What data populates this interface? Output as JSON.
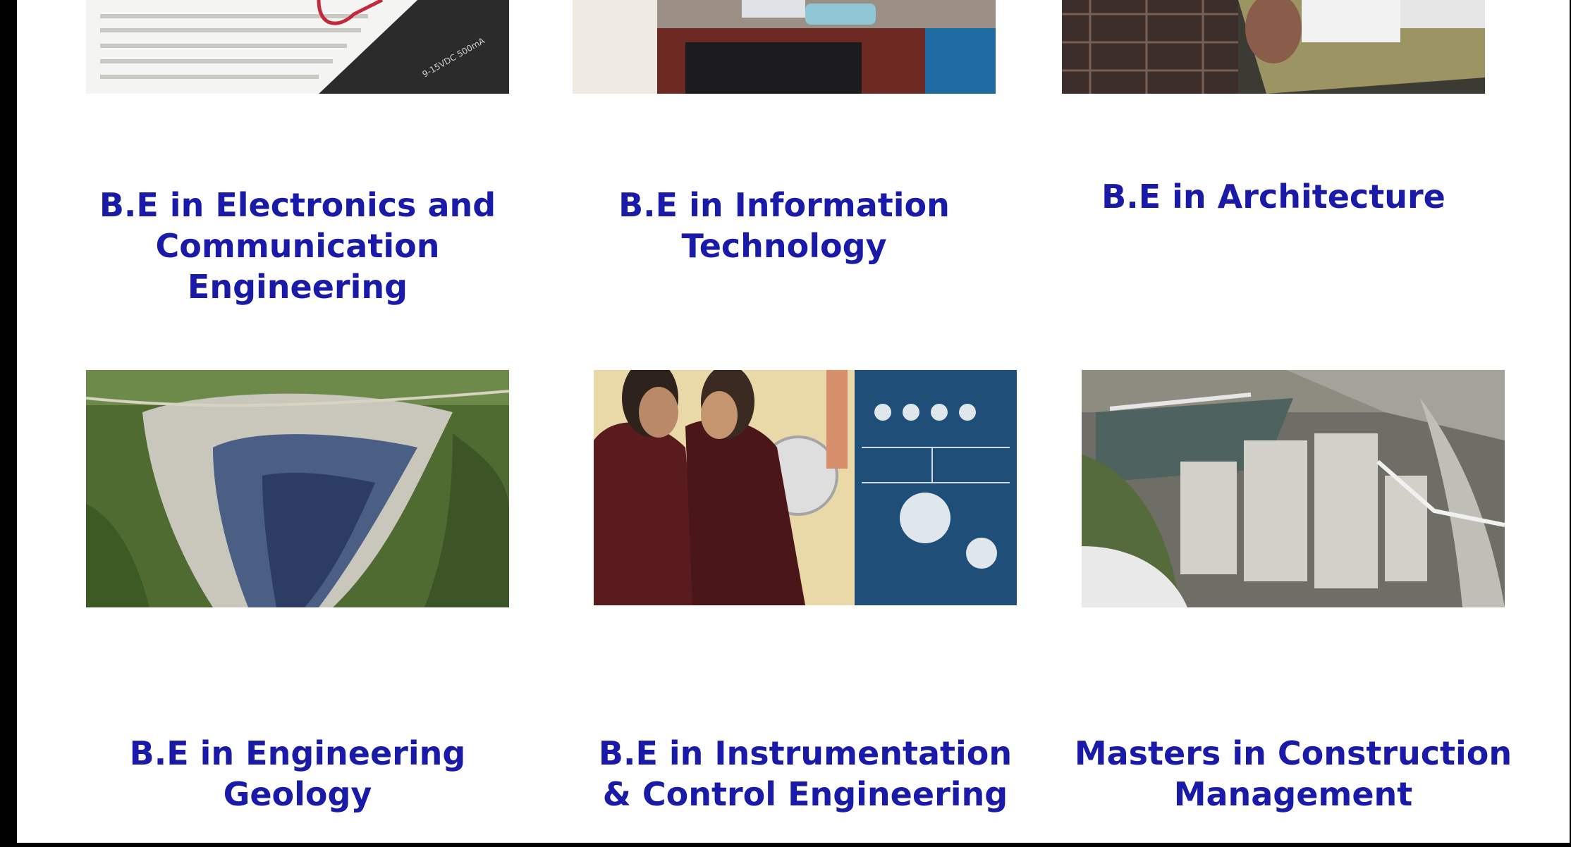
{
  "theme": {
    "title_color": "#1a1aa8",
    "frame_color": "#000000",
    "page_color": "#ffffff"
  },
  "programs": [
    {
      "title": "B.E in Electronics and Communication Engineering",
      "image_icon": "breadboard-photo"
    },
    {
      "title": "B.E in Information Technology",
      "image_icon": "office-computer-photo"
    },
    {
      "title": "B.E in Architecture",
      "image_icon": "architecture-model-photo"
    },
    {
      "title": "B.E in Engineering Geology",
      "image_icon": "landslide-aerial-photo"
    },
    {
      "title": "B.E in Instrumentation & Control Engineering",
      "image_icon": "control-panel-lab-photo"
    },
    {
      "title": "Masters in Construction Management",
      "image_icon": "dam-construction-photo"
    }
  ]
}
